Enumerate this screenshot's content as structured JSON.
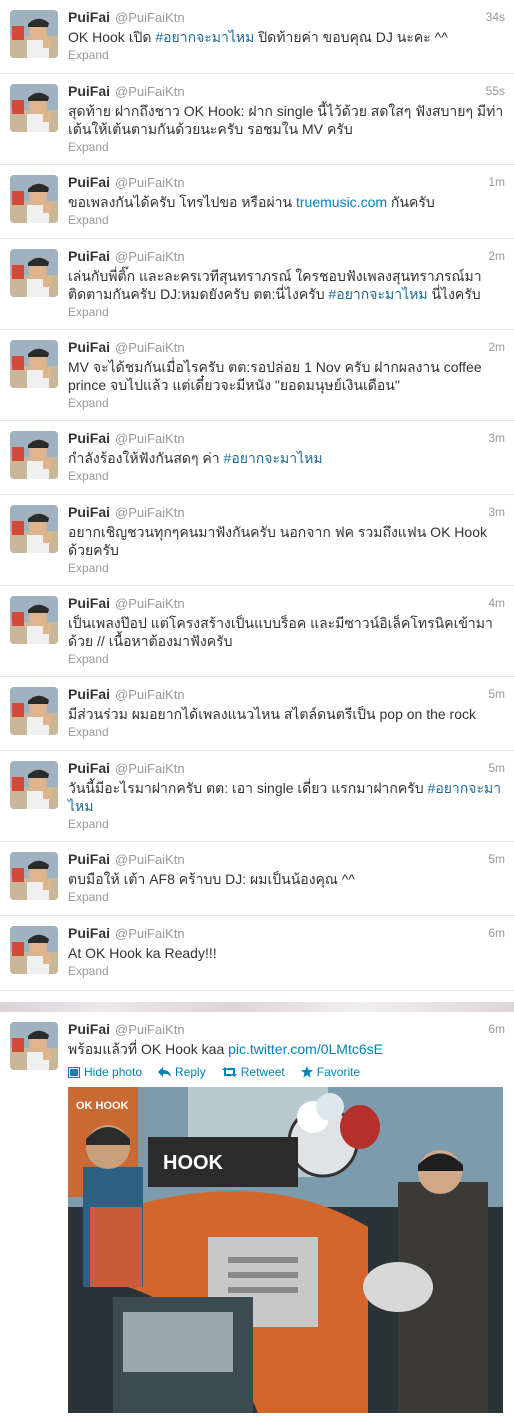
{
  "tweets": [
    {
      "name": "PuiFai",
      "handle": "@PuiFaiKtn",
      "time": "34s",
      "expand": "Expand",
      "segments": [
        {
          "t": "OK Hook เปิด "
        },
        {
          "t": "#อยากจะมาไหม",
          "k": "tag"
        },
        {
          "t": " ปิดท้ายค่า ขอบคุณ DJ นะคะ ^^"
        }
      ]
    },
    {
      "name": "PuiFai",
      "handle": "@PuiFaiKtn",
      "time": "55s",
      "expand": "Expand",
      "segments": [
        {
          "t": "สุดท้าย ฝากถึงชาว OK Hook: ฝาก single นี้ไว้ด้วย สดใสๆ ฟังสบายๆ มีท่าเต้นให้เต้นตามกันด้วยนะครับ รอชมใน MV ครับ"
        }
      ]
    },
    {
      "name": "PuiFai",
      "handle": "@PuiFaiKtn",
      "time": "1m",
      "expand": "Expand",
      "segments": [
        {
          "t": "ขอเพลงกันได้ครับ โทรไปขอ หรือผ่าน "
        },
        {
          "t": "truemusic.com",
          "k": "link"
        },
        {
          "t": " กันครับ"
        }
      ]
    },
    {
      "name": "PuiFai",
      "handle": "@PuiFaiKtn",
      "time": "2m",
      "expand": "Expand",
      "segments": [
        {
          "t": "เล่นกับพี่ติ๊ก และละครเวทีสุนทราภรณ์ ใครชอบฟังเพลงสุนทราภรณ์มาติดตามกันครับ DJ:หมดยังครับ ตต:นี่ไงครับ "
        },
        {
          "t": "#อยากจะมาไหม",
          "k": "tag"
        },
        {
          "t": " นี่ไงครับ"
        }
      ]
    },
    {
      "name": "PuiFai",
      "handle": "@PuiFaiKtn",
      "time": "2m",
      "expand": "Expand",
      "segments": [
        {
          "t": "MV จะได้ชมกันเมื่อไรครับ ตต:รอปล่อย 1 Nov ครับ ฝากผลงาน coffee prince จบไปแล้ว แต่เดี๋ยวจะมีหนัง \"ยอดมนุษย์เงินเดือน\""
        }
      ]
    },
    {
      "name": "PuiFai",
      "handle": "@PuiFaiKtn",
      "time": "3m",
      "expand": "Expand",
      "segments": [
        {
          "t": "กำลังร้องให้ฟังกันสดๆ ค่า "
        },
        {
          "t": "#อยากจะมาไหม",
          "k": "tag"
        }
      ]
    },
    {
      "name": "PuiFai",
      "handle": "@PuiFaiKtn",
      "time": "3m",
      "expand": "Expand",
      "segments": [
        {
          "t": "อยากเชิญชวนทุกๆคนมาฟังกันครับ นอกจาก ฟค รวมถึงแฟน OK Hook ด้วยครับ"
        }
      ]
    },
    {
      "name": "PuiFai",
      "handle": "@PuiFaiKtn",
      "time": "4m",
      "expand": "Expand",
      "segments": [
        {
          "t": "เป็นเพลงป๊อป แต่โครงสร้างเป็นแบบร็อค และมีซาวน์อิเล็คโทรนิคเข้ามาด้วย // เนื้อหาต้องมาฟังครับ"
        }
      ]
    },
    {
      "name": "PuiFai",
      "handle": "@PuiFaiKtn",
      "time": "5m",
      "expand": "Expand",
      "segments": [
        {
          "t": "มีส่วนร่วม ผมอยากได้เพลงแนวไหน สไตล์ดนตรีเป็น pop on the rock"
        }
      ]
    },
    {
      "name": "PuiFai",
      "handle": "@PuiFaiKtn",
      "time": "5m",
      "expand": "Expand",
      "segments": [
        {
          "t": "วันนี้มีอะไรมาฝากครับ ตต: เอา single เดี่ยว แรกมาฝากครับ "
        },
        {
          "t": "#อยากจะมาไหม",
          "k": "tag"
        }
      ]
    },
    {
      "name": "PuiFai",
      "handle": "@PuiFaiKtn",
      "time": "5m",
      "expand": "Expand",
      "segments": [
        {
          "t": "ตบมือให้ เต้า AF8 คร้าบบ DJ: ผมเป็นน้องคุณ ^^"
        }
      ]
    },
    {
      "name": "PuiFai",
      "handle": "@PuiFaiKtn",
      "time": "6m",
      "expand": "Expand",
      "segments": [
        {
          "t": "At OK Hook ka Ready!!!"
        }
      ]
    }
  ],
  "photo_tweet": {
    "name": "PuiFai",
    "handle": "@PuiFaiKtn",
    "time": "6m",
    "text": "พร้อมแล้วที่ OK Hook kaa ",
    "link": "pic.twitter.com/0LMtc6sE",
    "actions": {
      "hide_photo": "Hide photo",
      "reply": "Reply",
      "retweet": "Retweet",
      "favorite": "Favorite"
    },
    "photo_signs": [
      "OK HOOK",
      "HOOK"
    ]
  },
  "colors": {
    "link": "#0084b4",
    "hashtag": "#1f6a93",
    "meta": "#999999",
    "divider": "#e8e8e8"
  }
}
